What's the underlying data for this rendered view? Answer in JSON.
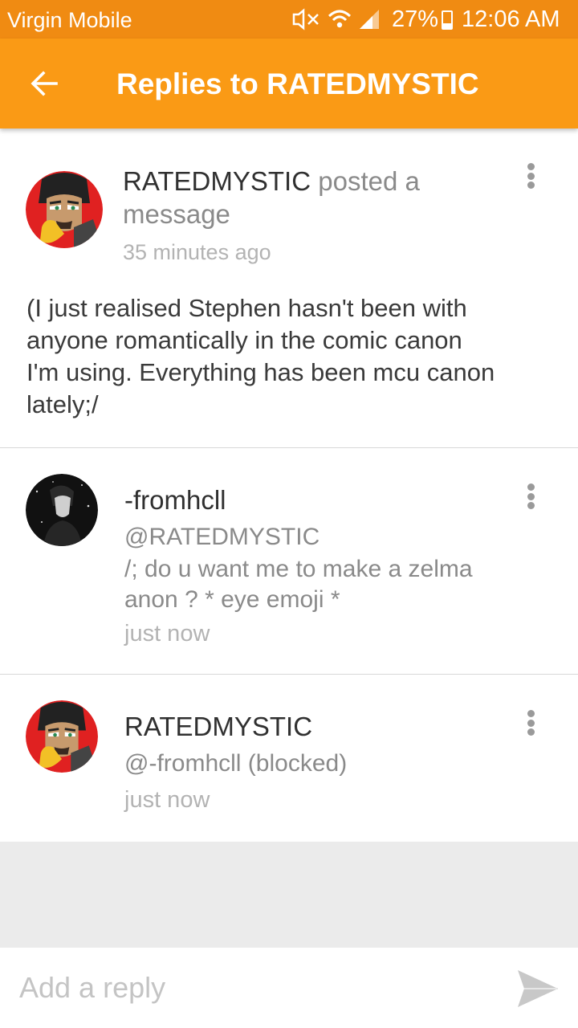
{
  "status_bar": {
    "carrier": "Virgin Mobile",
    "battery_percent": "27%",
    "time": "12:06 AM",
    "icons": [
      "mute-icon",
      "wifi-icon",
      "signal-icon",
      "battery-icon"
    ]
  },
  "toolbar": {
    "title": "Replies to RATEDMYSTIC",
    "back_icon": "arrow-left-icon"
  },
  "colors": {
    "toolbar": "#fa9a15",
    "status_bar": "#f08b12"
  },
  "post": {
    "author": "RATEDMYSTIC",
    "action": "posted a",
    "action_line2": "message",
    "time": "35 minutes ago",
    "body_lines": [
      "(I just realised Stephen hasn't been with",
      "anyone romantically in the comic canon",
      "I'm using. Everything has been mcu canon",
      "lately;/"
    ]
  },
  "replies": [
    {
      "author": "-fromhcll",
      "mention": "@RATEDMYSTIC",
      "text_line1": "/; do u want me to make a zelma",
      "text_line2": "anon ? * eye emoji *",
      "time": "just now"
    },
    {
      "author": "RATEDMYSTIC",
      "mention": "@-fromhcll (blocked)",
      "time": "just now"
    }
  ],
  "composer": {
    "placeholder": "Add a reply",
    "send_icon": "send-icon"
  }
}
